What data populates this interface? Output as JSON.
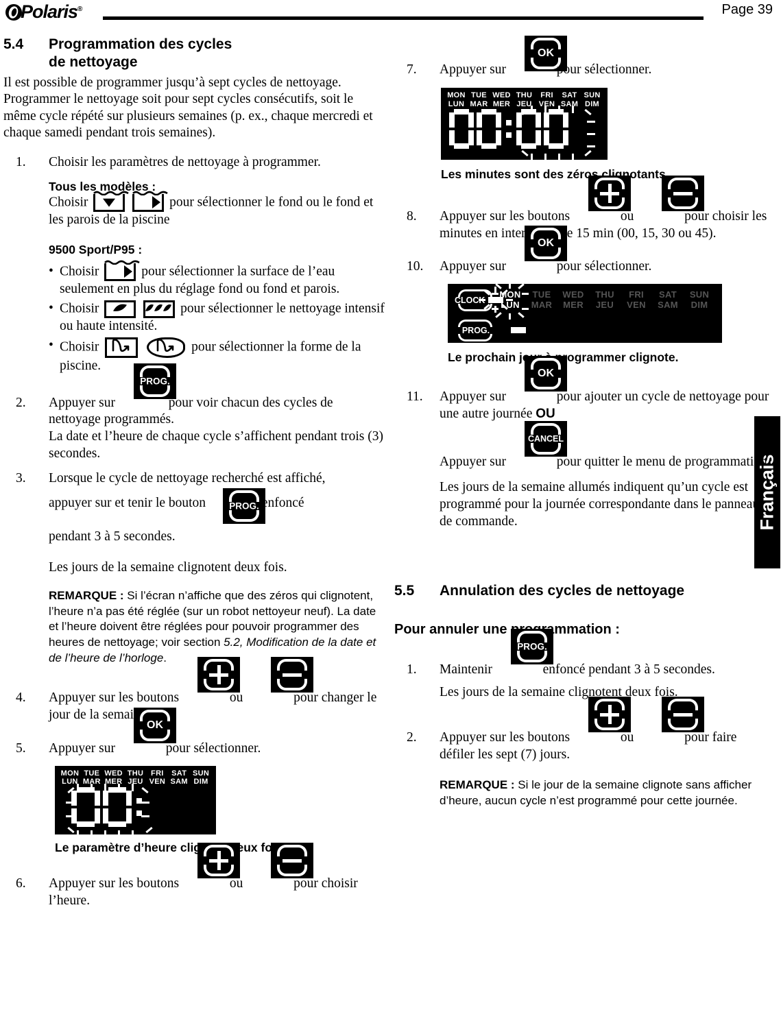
{
  "header": {
    "brand": "Polaris",
    "brand_mark": "polaris-logo-icon",
    "registered": "®",
    "page_label": "Page 39"
  },
  "language_tab": {
    "label": "Français"
  },
  "left_column": {
    "section": {
      "number": "5.4",
      "title_line1": "Programmation des cycles",
      "title_line2": "de nettoyage"
    },
    "intro": "Il est possible de programmer jusqu’à sept cycles de nettoyage. Programmer le nettoyage soit pour sept cycles consécutifs, soit le même cycle répété sur plusieurs semaines (p. ex., chaque mercredi et chaque samedi pendant trois semaines).",
    "step1": {
      "number": "1.",
      "text": "Choisir les paramètres de nettoyage à programmer."
    },
    "all_models": {
      "heading": "Tous les modèles :",
      "text_before": "Choisir",
      "text_after": "pour sélectionner le fond ou le fond et les parois de la piscine"
    },
    "sport_heading": "9500 Sport/P95 :",
    "bullets": [
      {
        "dot": "•",
        "before": "Choisir",
        "after": "pour sélectionner la surface de l’eau seulement en plus du réglage fond ou fond et parois."
      },
      {
        "dot": "•",
        "before": "Choisir",
        "after": "pour sélectionner le nettoyage intensif ou haute intensité."
      },
      {
        "dot": "•",
        "before": "Choisir",
        "after": "pour sélectionner la forme de la piscine."
      }
    ],
    "step2": {
      "number": "2.",
      "before": "Appuyer sur",
      "after": "pour voir chacun des cycles de nettoyage programmés.",
      "extra": "La date et l’heure de chaque cycle s’affichent pendant trois (3) secondes."
    },
    "step3": {
      "number": "3.",
      "line1": "Lorsque le cycle de nettoyage recherché est affiché,",
      "line2_before": "appuyer sur et tenir le bouton",
      "line2_after": "enfoncé",
      "line3": "pendant 3 à 5 secondes.",
      "extra": "Les jours de la semaine clignotent deux fois."
    },
    "remarque1": {
      "label": "REMARQUE :",
      "text_a": " Si l’écran n’affiche que des zéros qui clignotent, l’heure n’a pas été réglée (sur un robot nettoyeur neuf). La date et l’heure doivent être réglées pour pouvoir programmer des heures de nettoyage; voir section ",
      "italic": "5.2, Modification de la date et de l’heure de l’horloge",
      "text_b": "."
    },
    "step4": {
      "number": "4.",
      "before": "Appuyer sur les boutons",
      "middle": "ou",
      "after": "pour changer le jour de la semaine."
    },
    "step5": {
      "number": "5.",
      "before": "Appuyer sur",
      "after": "pour sélectionner."
    },
    "caption_hour": "Le paramètre d’heure clignote deux fois.",
    "step6": {
      "number": "6.",
      "before": "Appuyer sur les boutons",
      "middle": "ou",
      "after": "pour choisir l’heure."
    }
  },
  "right_column": {
    "step7": {
      "number": "7.",
      "before": "Appuyer sur",
      "after": "pour sélectionner."
    },
    "caption_minutes": "Les minutes sont des zéros clignotants.",
    "step8": {
      "number": "8.",
      "before": "Appuyer sur les boutons",
      "middle": "ou",
      "after": "pour choisir les minutes en intervalles de 15 min (00, 15, 30 ou 45)."
    },
    "step10": {
      "number": "10.",
      "before": "Appuyer sur",
      "after": "pour sélectionner."
    },
    "caption_nextday": "Le prochain jour à programmer clignote.",
    "step11": {
      "number": "11.",
      "before": "Appuyer sur",
      "after": "pour ajouter un cycle de nettoyage pour une autre journée ",
      "or": "OU",
      "cancel_before": "Appuyer sur",
      "cancel_after": "pour quitter le menu de programmation.",
      "extra": "Les jours de la semaine allumés indiquent qu’un cycle est programmé pour la journée correspondante dans le panneau de commande."
    },
    "section55": {
      "number": "5.5",
      "title": "Annulation des cycles de nettoyage"
    },
    "cancel_heading": "Pour annuler une programmation :",
    "c_step1": {
      "number": "1.",
      "before": "Maintenir",
      "after": "enfoncé pendant 3 à 5 secondes.",
      "extra": "Les jours de la semaine clignotent deux fois."
    },
    "c_step2": {
      "number": "2.",
      "before": "Appuyer sur les boutons",
      "middle": "ou",
      "after": "pour faire défiler les sept (7) jours."
    },
    "remarque2": {
      "label": "REMARQUE :",
      "text": " Si le jour de la semaine clignote sans afficher d’heure, aucun cycle n’est programmé pour cette journée."
    }
  },
  "buttons": {
    "prog": "PROG.",
    "ok": "OK",
    "cancel": "CANCEL",
    "plus": "+",
    "minus": "−"
  },
  "lcd": {
    "days_en": [
      "MON",
      "TUE",
      "WED",
      "THU",
      "FRI",
      "SAT",
      "SUN"
    ],
    "days_fr": [
      "LUN",
      "MAR",
      "MER",
      "JEU",
      "VEN",
      "SAM",
      "DIM"
    ],
    "clock_label": "CLOCK",
    "prog_label": "PROG.",
    "panel_hour": {
      "value": "00:",
      "caption_ref": "hour-flashing"
    },
    "panel_time": {
      "value": "00:00",
      "caption_ref": "minutes-flashing"
    },
    "panel_day": {
      "active_day_en": "MON",
      "active_day_fr": "LUN"
    }
  },
  "colors": {
    "ink": "#000000",
    "paper": "#ffffff",
    "lcd_background": "#000000",
    "lcd_on": "#ffffff",
    "lcd_off": "#555555"
  }
}
